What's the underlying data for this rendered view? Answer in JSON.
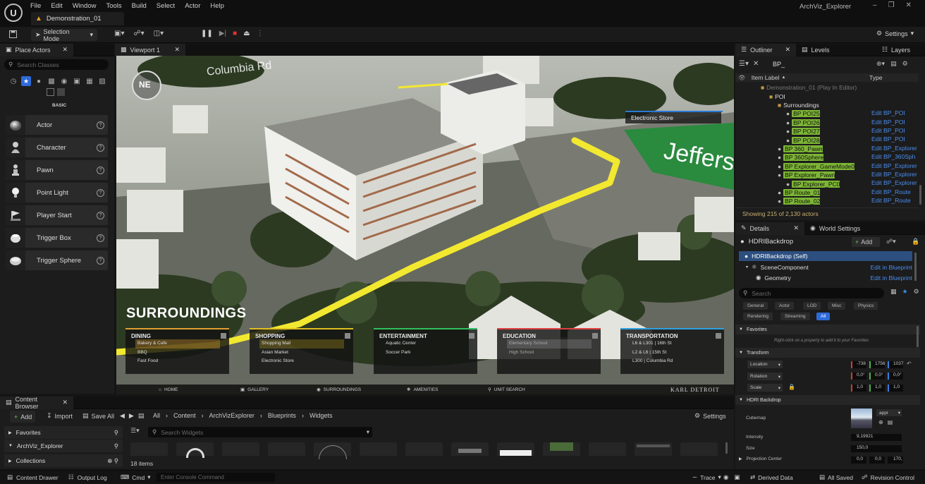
{
  "app": {
    "logo_letter": "U",
    "title": "ArchViz_Explorer",
    "document_tab": "Demonstration_01",
    "menu": [
      "File",
      "Edit",
      "Window",
      "Tools",
      "Build",
      "Select",
      "Actor",
      "Help"
    ]
  },
  "toolbar": {
    "mode_label": "Selection Mode",
    "settings_label": "Settings"
  },
  "place_actors": {
    "tab_label": "Place Actors",
    "search_placeholder": "Search Classes",
    "category_label": "BASIC",
    "items": [
      {
        "label": "Actor",
        "icon": "sphere-icon"
      },
      {
        "label": "Character",
        "icon": "character-icon"
      },
      {
        "label": "Pawn",
        "icon": "pawn-icon"
      },
      {
        "label": "Point Light",
        "icon": "lightbulb-icon"
      },
      {
        "label": "Player Start",
        "icon": "flag-icon"
      },
      {
        "label": "Trigger Box",
        "icon": "box-icon"
      },
      {
        "label": "Trigger Sphere",
        "icon": "sphere-icon"
      }
    ]
  },
  "viewport": {
    "tab_label": "Viewport 1",
    "compass": "NE",
    "street_top": "Columbia Rd",
    "street_right": "Jeffers",
    "store_label": "Electronic Store",
    "heading": "SURROUNDINGS",
    "poi_cards": [
      {
        "title": "DINING",
        "color": "#e0a030",
        "items": [
          "Bakery & Cafe",
          "BBQ",
          "Fast Food"
        ]
      },
      {
        "title": "SHOPPING",
        "color": "#e0c020",
        "items": [
          "Shopping Mall",
          "Asian Market",
          "Electronic Store"
        ]
      },
      {
        "title": "ENTERTAINMENT",
        "color": "#30c060",
        "items": [
          "Aquatic Center",
          "Soccer Park"
        ]
      },
      {
        "title": "EDUCATION",
        "color": "#e04040",
        "items": [
          "Elementary School",
          "High School"
        ]
      },
      {
        "title": "TRANSPORTATION",
        "color": "#30a0e0",
        "items": [
          "L6 & L301 | 16th St",
          "L2 & L6 | 15th St",
          "L300 | Columbia Rd"
        ]
      }
    ],
    "nav": [
      "HOME",
      "GALLERY",
      "SURROUNDINGS",
      "AMENITIES",
      "UNIT SEARCH"
    ],
    "brand": "KARL DETROIT"
  },
  "outliner": {
    "tabs": [
      "Outliner",
      "Levels",
      "Layers"
    ],
    "search_value": "BP_",
    "col_label": "Item Label",
    "col_type": "Type",
    "rows": [
      {
        "label": "Demonstration_01 (Play In Editor)",
        "indent": 0,
        "bp": false,
        "type": ""
      },
      {
        "label": "POI",
        "indent": 1,
        "bp": false,
        "type": ""
      },
      {
        "label": "Surroundings",
        "indent": 2,
        "bp": false,
        "type": ""
      },
      {
        "label": "POI25",
        "indent": 3,
        "bp": true,
        "type": "Edit BP_POI"
      },
      {
        "label": "POI26",
        "indent": 3,
        "bp": true,
        "type": "Edit BP_POI"
      },
      {
        "label": "POI27",
        "indent": 3,
        "bp": true,
        "type": "Edit BP_POI"
      },
      {
        "label": "POI28",
        "indent": 3,
        "bp": true,
        "type": "Edit BP_POI"
      },
      {
        "label": "360_Pawn",
        "indent": 2,
        "bp": true,
        "type": "Edit BP_Explorer"
      },
      {
        "label": "360Sphere",
        "indent": 2,
        "bp": true,
        "type": "Edit BP_360Sph"
      },
      {
        "label": "Explorer_GameMode0",
        "indent": 2,
        "bp": true,
        "type": "Edit BP_Explorer"
      },
      {
        "label": "Explorer_Pawn",
        "indent": 2,
        "bp": true,
        "type": "Edit BP_Explorer"
      },
      {
        "label": "Explorer_PC0",
        "indent": 3,
        "bp": true,
        "type": "Edit BP_Explorer"
      },
      {
        "label": "Route_01",
        "indent": 2,
        "bp": true,
        "type": "Edit BP_Route"
      },
      {
        "label": "Route_02",
        "indent": 2,
        "bp": true,
        "type": "Edit BP_Route"
      }
    ],
    "count_text": "Showing 215 of 2,130 actors"
  },
  "details": {
    "tabs": [
      "Details",
      "World Settings"
    ],
    "object_name": "HDRIBackdrop",
    "add_label": "Add",
    "components": [
      {
        "label": "HDRIBackdrop (Self)",
        "link": ""
      },
      {
        "label": "SceneComponent",
        "link": "Edit in Blueprint"
      },
      {
        "label": "Geometry",
        "link": "Edit in Blueprint"
      }
    ],
    "search_placeholder": "Search",
    "filters_row1": [
      "General",
      "Actor",
      "LOD",
      "Misc",
      "Physics"
    ],
    "filters_row2": [
      "Rendering",
      "Streaming",
      "All"
    ],
    "favorites_title": "Favorites",
    "favorites_hint": "Right-click on a property to add it to your Favorites",
    "transform_title": "Transform",
    "location": {
      "label": "Location",
      "values": [
        "-738",
        "1756",
        "1037"
      ]
    },
    "rotation": {
      "label": "Rotation",
      "values": [
        "0,0°",
        "0,0°",
        "0,0°"
      ]
    },
    "scale": {
      "label": "Scale",
      "values": [
        "1,0",
        "1,0",
        "1,0"
      ]
    },
    "hdri_title": "HDRI Backdrop",
    "cubemap_label": "Cubemap",
    "cubemap_value": "appr",
    "intensity_label": "Intensity",
    "intensity_value": "9,19921",
    "size_label": "Size",
    "size_value": "150,0",
    "projection_label": "Projection Center",
    "projection_values": [
      "0,0",
      "0,0",
      "170,"
    ]
  },
  "content_browser": {
    "tab_label": "Content Browser",
    "add_label": "Add",
    "import_label": "Import",
    "save_all_label": "Save All",
    "breadcrumb": [
      "All",
      "Content",
      "ArchVizExplorer",
      "Blueprints",
      "Widgets"
    ],
    "settings_label": "Settings",
    "side": [
      "Favorites",
      "ArchViz_Explorer",
      "Collections"
    ],
    "search_placeholder": "Search Widgets",
    "item_count": "18 items"
  },
  "statusbar": {
    "content_drawer": "Content Drawer",
    "output_log": "Output Log",
    "cmd": "Cmd",
    "console_placeholder": "Enter Console Command",
    "trace": "Trace",
    "derived_data": "Derived Data",
    "all_saved": "All Saved",
    "revision_control": "Revision Control"
  }
}
